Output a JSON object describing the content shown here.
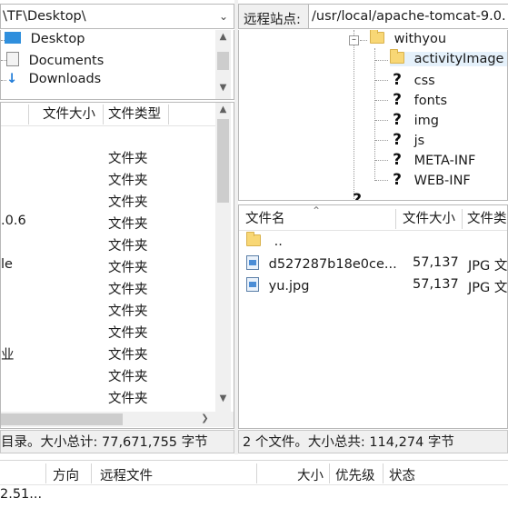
{
  "left": {
    "path": "\\TF\\Desktop\\",
    "tree": [
      {
        "label": "Desktop",
        "icon": "desktop-icon"
      },
      {
        "label": "Documents",
        "icon": "documents-icon"
      },
      {
        "label": "Downloads",
        "icon": "downloads-icon"
      }
    ],
    "columns": {
      "size": "文件大小",
      "type": "文件类型"
    },
    "files": [
      {
        "name": "",
        "type": "文件夹"
      },
      {
        "name": "",
        "type": "文件夹"
      },
      {
        "name": "",
        "type": "文件夹"
      },
      {
        "name": ".0.6",
        "type": "文件夹"
      },
      {
        "name": "",
        "type": "文件夹"
      },
      {
        "name": "le",
        "type": "文件夹"
      },
      {
        "name": "",
        "type": "文件夹"
      },
      {
        "name": "",
        "type": "文件夹"
      },
      {
        "name": "",
        "type": "文件夹"
      },
      {
        "name": "业",
        "type": "文件夹"
      },
      {
        "name": "",
        "type": "文件夹"
      },
      {
        "name": "",
        "type": "文件夹"
      }
    ],
    "status": "目录。大小总计: 77,671,755 字节"
  },
  "right": {
    "site_label": "远程站点:",
    "path": "/usr/local/apache-tomcat-9.0.",
    "tree": [
      {
        "label": "withyou",
        "icon": "folder-open-icon"
      },
      {
        "label": "activityImage",
        "icon": "folder-icon"
      },
      {
        "label": "css",
        "icon": "question-folder-icon"
      },
      {
        "label": "fonts",
        "icon": "question-folder-icon"
      },
      {
        "label": "img",
        "icon": "question-folder-icon"
      },
      {
        "label": "js",
        "icon": "question-folder-icon"
      },
      {
        "label": "META-INF",
        "icon": "question-folder-icon"
      },
      {
        "label": "WEB-INF",
        "icon": "question-folder-icon"
      }
    ],
    "columns": {
      "name": "文件名",
      "size": "文件大小",
      "type": "文件类"
    },
    "files": [
      {
        "name": "..",
        "size": "",
        "type": "",
        "icon": "folder-icon"
      },
      {
        "name": "d527287b18e0ce...",
        "size": "57,137",
        "type": "JPG 文",
        "icon": "image-file-icon"
      },
      {
        "name": "yu.jpg",
        "size": "57,137",
        "type": "JPG 文",
        "icon": "image-file-icon"
      }
    ],
    "status": "2 个文件。大小总共: 114,274 字节"
  },
  "queue": {
    "columns": {
      "direction": "方向",
      "remote": "远程文件",
      "size": "大小",
      "priority": "优先级",
      "state": "状态"
    },
    "first_item": "2.51..."
  }
}
